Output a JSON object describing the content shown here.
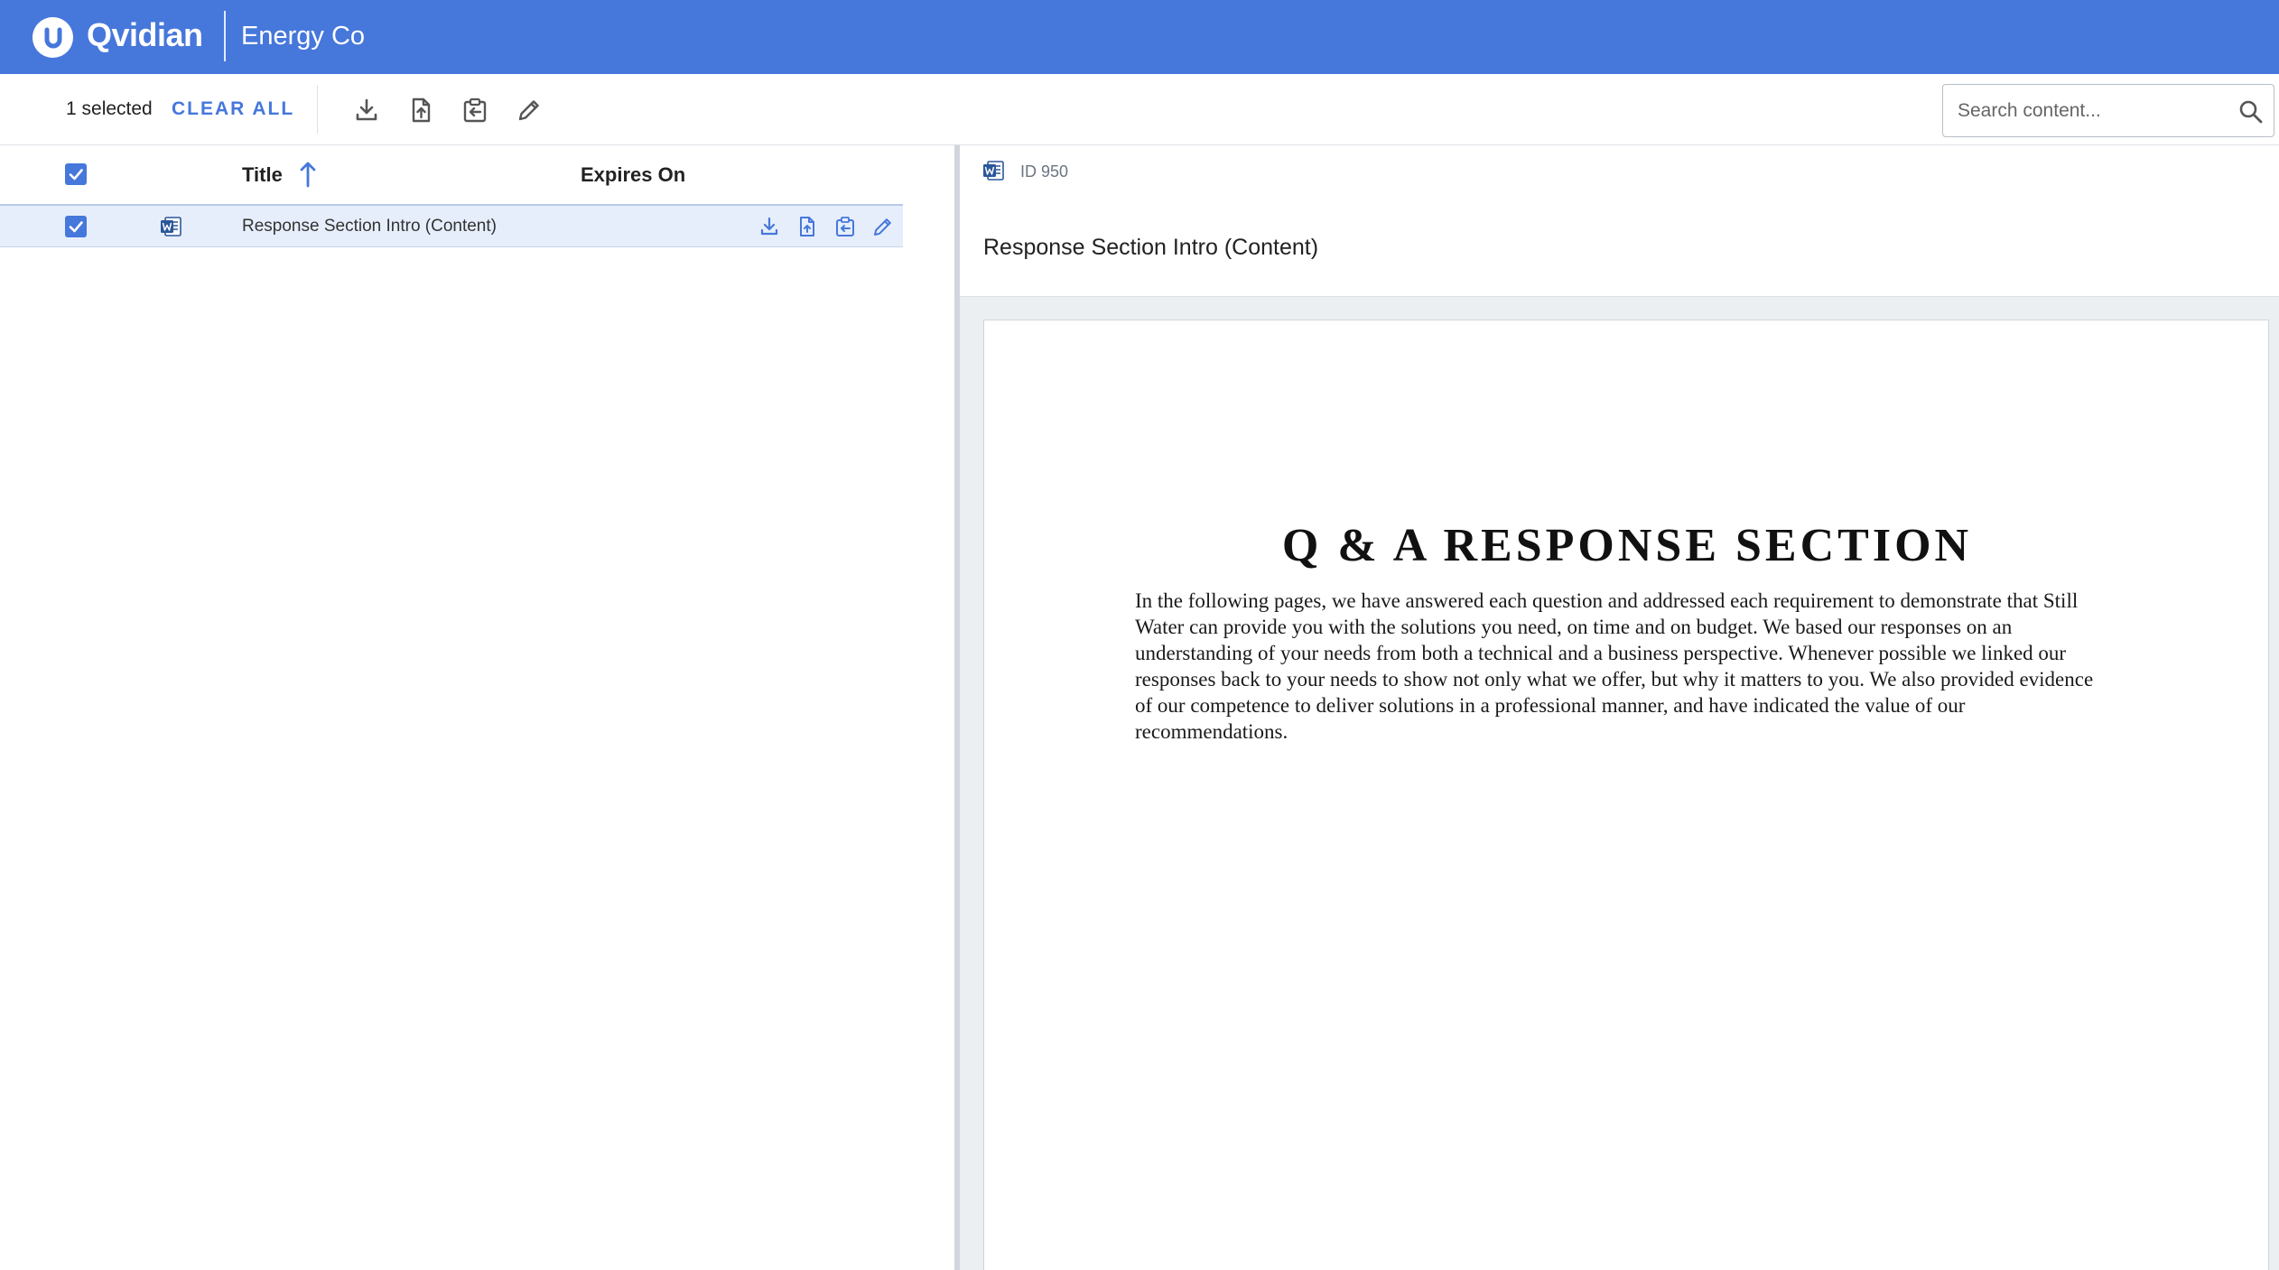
{
  "header": {
    "logo_letter": "U",
    "brand": "Qvidian",
    "org": "Energy Co"
  },
  "toolbar": {
    "selected_text": "1 selected",
    "clear_all": "CLEAR ALL",
    "icons": [
      "download-icon",
      "upload-file-icon",
      "insert-icon",
      "edit-icon"
    ],
    "search": {
      "placeholder": "Search content...",
      "value": ""
    }
  },
  "list": {
    "columns": {
      "title": "Title",
      "expires": "Expires On"
    },
    "sort": "ascending",
    "rows": [
      {
        "selected": true,
        "type_icon": "word-doc-icon",
        "title": "Response Section Intro (Content)",
        "expires": "",
        "actions": [
          "download-icon",
          "upload-file-icon",
          "insert-icon",
          "edit-icon"
        ]
      }
    ]
  },
  "preview": {
    "id_label": "ID 950",
    "title": "Response Section Intro (Content)",
    "document": {
      "heading": "Q & A RESPONSE SECTION",
      "body": "In the following pages, we have answered each question and addressed each requirement to demonstrate that Still Water can provide you with the solutions you need, on time and on budget. We based our responses on an understanding of your needs from both a technical and a business perspective. Whenever possible we linked our responses back to your needs to show not only what we offer, but why it matters to you. We also provided evidence of our competence to deliver solutions in a professional manner, and have indicated the value of our recommendations."
    }
  },
  "colors": {
    "brand": "#4677db",
    "selected_row": "#e6eefb",
    "pane_bg": "#eceff2"
  }
}
